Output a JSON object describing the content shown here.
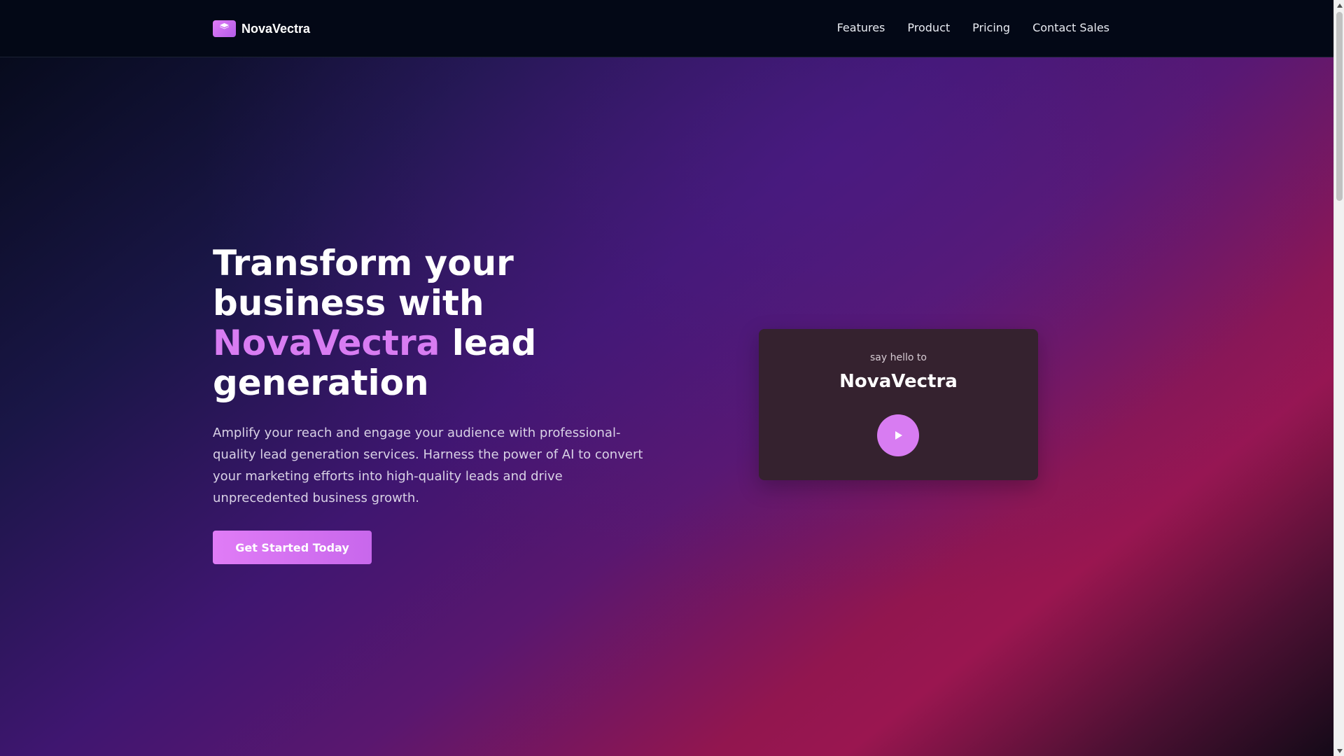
{
  "brand": {
    "name": "NovaVectra",
    "logo_icon": "box-icon"
  },
  "nav": {
    "items": [
      {
        "label": "Features"
      },
      {
        "label": "Product"
      },
      {
        "label": "Pricing"
      },
      {
        "label": "Contact Sales"
      }
    ]
  },
  "hero": {
    "headline_part1": "Transform your business with",
    "headline_accent": "NovaVectra",
    "headline_part2": "lead generation",
    "description": "Amplify your reach and engage your audience with professional-quality lead generation services. Harness the power of AI to convert your marketing efforts into high-quality leads and drive unprecedented business growth.",
    "cta_label": "Get Started Today"
  },
  "video_card": {
    "kicker": "say hello to",
    "title": "NovaVectra",
    "play_icon": "play-icon"
  },
  "colors": {
    "accent": "#d87cf2",
    "nav_background": "#030816",
    "card_background": "#35222f"
  }
}
